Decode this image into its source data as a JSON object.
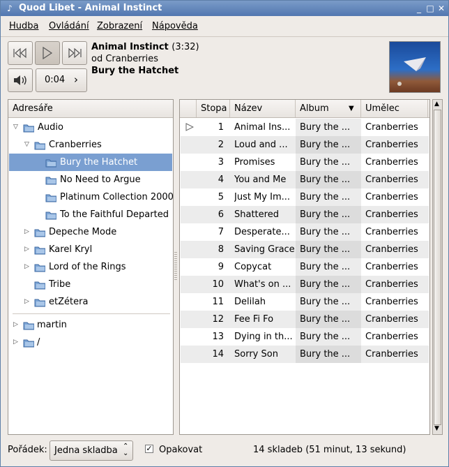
{
  "window": {
    "title": "Quod Libet - Animal Instinct"
  },
  "menubar": {
    "items": [
      "Hudba",
      "Ovládání",
      "Zobrazení",
      "Nápověda"
    ]
  },
  "player": {
    "song_title": "Animal Instinct",
    "song_length": "(3:32)",
    "artist_line": "od Cranberries",
    "album": "Bury the Hatchet",
    "position": "0:04"
  },
  "colors": {
    "selection": "#7a9fd1",
    "stripe": "#ececec",
    "titlebar": "#5e7fa8"
  },
  "folders": {
    "header": "Adresáře",
    "items": [
      {
        "label": "Audio",
        "expander": "▽",
        "level": 0
      },
      {
        "label": "Cranberries",
        "expander": "▽",
        "level": 1
      },
      {
        "label": "Bury the Hatchet",
        "expander": "",
        "level": 2,
        "selected": true
      },
      {
        "label": "No Need to Argue",
        "expander": "",
        "level": 2
      },
      {
        "label": "Platinum Collection 2000",
        "expander": "",
        "level": 2
      },
      {
        "label": "To the Faithful Departed",
        "expander": "",
        "level": 2
      },
      {
        "label": "Depeche Mode",
        "expander": "▷",
        "level": 1
      },
      {
        "label": "Karel Kryl",
        "expander": "▷",
        "level": 1
      },
      {
        "label": "Lord of the Rings",
        "expander": "▷",
        "level": 1
      },
      {
        "label": "Tribe",
        "expander": "",
        "level": 1
      },
      {
        "label": "etZétera",
        "expander": "▷",
        "level": 1
      }
    ],
    "extra_items": [
      {
        "label": "martin",
        "expander": "▷"
      },
      {
        "label": "/",
        "expander": "▷"
      }
    ]
  },
  "songs": {
    "columns": [
      "Stopa",
      "Název",
      "Album",
      "Umělec"
    ],
    "rows": [
      {
        "track": "1",
        "title": "Animal Ins...",
        "album": "Bury the ...",
        "artist": "Cranberries",
        "playing": true
      },
      {
        "track": "2",
        "title": "Loud and ...",
        "album": "Bury the ...",
        "artist": "Cranberries"
      },
      {
        "track": "3",
        "title": "Promises",
        "album": "Bury the ...",
        "artist": "Cranberries"
      },
      {
        "track": "4",
        "title": "You and Me",
        "album": "Bury the ...",
        "artist": "Cranberries"
      },
      {
        "track": "5",
        "title": "Just My Im...",
        "album": "Bury the ...",
        "artist": "Cranberries"
      },
      {
        "track": "6",
        "title": "Shattered",
        "album": "Bury the ...",
        "artist": "Cranberries"
      },
      {
        "track": "7",
        "title": "Desperate...",
        "album": "Bury the ...",
        "artist": "Cranberries"
      },
      {
        "track": "8",
        "title": "Saving Grace",
        "album": "Bury the ...",
        "artist": "Cranberries"
      },
      {
        "track": "9",
        "title": "Copycat",
        "album": "Bury the ...",
        "artist": "Cranberries"
      },
      {
        "track": "10",
        "title": "What's on ...",
        "album": "Bury the ...",
        "artist": "Cranberries"
      },
      {
        "track": "11",
        "title": "Delilah",
        "album": "Bury the ...",
        "artist": "Cranberries"
      },
      {
        "track": "12",
        "title": "Fee Fi Fo",
        "album": "Bury the ...",
        "artist": "Cranberries"
      },
      {
        "track": "13",
        "title": "Dying in th...",
        "album": "Bury the ...",
        "artist": "Cranberries"
      },
      {
        "track": "14",
        "title": "Sorry Son",
        "album": "Bury the ...",
        "artist": "Cranberries"
      }
    ]
  },
  "footer": {
    "order_label": "Pořádek:",
    "order_value": "Jedna skladba",
    "repeat_label": "Opakovat",
    "repeat_checked": true,
    "status": "14 skladeb (51 minut, 13 sekund)"
  }
}
